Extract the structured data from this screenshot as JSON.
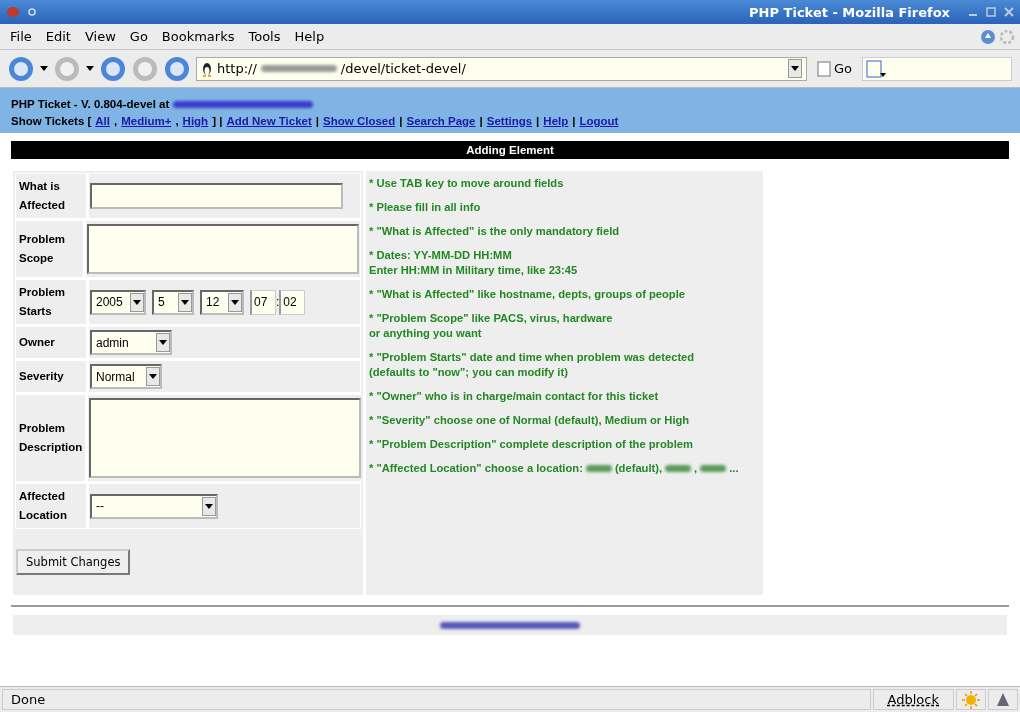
{
  "window": {
    "title": "PHP Ticket - Mozilla Firefox"
  },
  "menu": [
    "File",
    "Edit",
    "View",
    "Go",
    "Bookmarks",
    "Tools",
    "Help"
  ],
  "toolbar": {
    "url_start": "http://",
    "url_end": "/devel/ticket-devel/",
    "go": "Go"
  },
  "page_header": {
    "title": "PHP Ticket - V. 0.804-devel at",
    "nav": [
      {
        "kind": "text",
        "text": "Show Tickets ["
      },
      {
        "kind": "link",
        "text": "All"
      },
      {
        "kind": "text",
        "text": ","
      },
      {
        "kind": "link",
        "text": "Medium+"
      },
      {
        "kind": "text",
        "text": ","
      },
      {
        "kind": "link",
        "text": "High"
      },
      {
        "kind": "text",
        "text": "] |"
      },
      {
        "kind": "link",
        "text": "Add New Ticket"
      },
      {
        "kind": "text",
        "text": "|"
      },
      {
        "kind": "link",
        "text": "Show Closed"
      },
      {
        "kind": "text",
        "text": "|"
      },
      {
        "kind": "link",
        "text": "Search Page"
      },
      {
        "kind": "text",
        "text": "|"
      },
      {
        "kind": "link",
        "text": "Settings"
      },
      {
        "kind": "text",
        "text": "|"
      },
      {
        "kind": "link",
        "text": "Help"
      },
      {
        "kind": "text",
        "text": "|"
      },
      {
        "kind": "link",
        "text": "Logout"
      }
    ]
  },
  "section_title": "Adding Element",
  "form": {
    "rows": [
      {
        "label": "What is Affected",
        "kind": "text"
      },
      {
        "label": "Problem Scope",
        "kind": "short_textarea"
      },
      {
        "label": "Problem Starts",
        "kind": "datetime",
        "year": "2005",
        "month": "5",
        "day": "12",
        "hour": "07",
        "separator": ":",
        "minute": "02"
      },
      {
        "label": "Owner",
        "kind": "select",
        "value": "admin"
      },
      {
        "label": "Severity",
        "kind": "select",
        "value": "Normal"
      },
      {
        "label": "Problem Description",
        "kind": "tall_textarea"
      },
      {
        "label": "Affected Location",
        "kind": "select",
        "value": "--"
      }
    ],
    "submit": "Submit Changes"
  },
  "help": [
    [
      "* Use TAB key to move around fields"
    ],
    [
      "* Please fill in all info"
    ],
    [
      "* \"What is Affected\" is the only mandatory field"
    ],
    [
      "* Dates: YY-MM-DD HH:MM",
      "Enter HH:MM in Military time, like 23:45"
    ],
    [
      "* \"What is Affected\" like hostname, depts, groups of people"
    ],
    [
      "* \"Problem Scope\" like PACS, virus, hardware",
      "or anything you want"
    ],
    [
      "* \"Problem Starts\" date and time when problem was detected",
      "(defaults to \"now\"; you can modify it)"
    ],
    [
      "* \"Owner\" who is in charge/main contact for this ticket"
    ],
    [
      "* \"Severity\" choose one of Normal (default), Medium or High"
    ],
    [
      "* \"Problem Description\" complete description of the problem"
    ]
  ],
  "help_last": [
    {
      "kind": "text",
      "text": "* \"Affected Location\" choose a location:"
    },
    {
      "kind": "redacted"
    },
    {
      "kind": "text",
      "text": "(default),"
    },
    {
      "kind": "redacted"
    },
    {
      "kind": "text",
      "text": ","
    },
    {
      "kind": "redacted"
    },
    {
      "kind": "text",
      "text": "..."
    }
  ],
  "status_bar": {
    "text": "Done",
    "adblock": "Adblock"
  }
}
